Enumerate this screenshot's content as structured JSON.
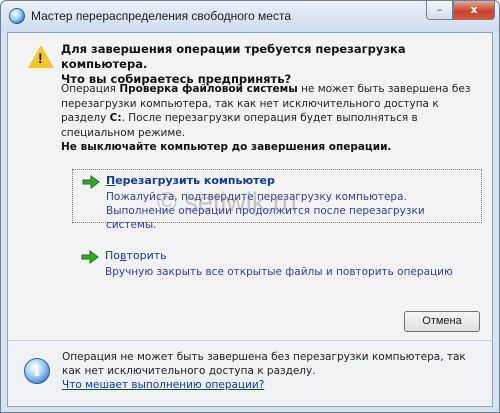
{
  "window": {
    "title": "Мастер перераспределения свободного места",
    "minimize_glyph": "–",
    "close_glyph": "x"
  },
  "dialog": {
    "heading_line1": "Для завершения операции требуется перезагрузка компьютера.",
    "heading_line2": "Что вы собираетесь предпринять?",
    "body_prefix": "Операция ",
    "body_operation": "Проверка файловой системы",
    "body_mid": " не может быть завершена без перезагрузки компьютера, так как нет исключительного доступа к разделу ",
    "body_drive": "C:",
    "body_suffix": ". После перезагрузки операция будет выполняться в специальном режиме.",
    "body_warning": "Не выключайте компьютер до завершения операции."
  },
  "options": [
    {
      "title_underlined_letter": "П",
      "title_rest": "ерезагрузить компьютер",
      "description": "Пожалуйста, подтвердите перезагрузку компьютера. Выполнение операции продолжится после перезагрузки системы.",
      "icon": "green-arrow-icon"
    },
    {
      "title_prefix": "По",
      "title_underlined_letter": "в",
      "title_rest": "торить",
      "description": "Вручную закрыть все открытые файлы и повторить операцию",
      "icon": "green-arrow-icon"
    }
  ],
  "buttons": {
    "cancel": "Отмена"
  },
  "footer": {
    "text": "Операция не может быть завершена без перезагрузки компьютера, так как нет исключительного доступа к разделу.",
    "link": "Что мешает выполнению операции?",
    "icon": "info-icon"
  },
  "watermark": "© setiwik.ru",
  "colors": {
    "link": "#0f3aa7",
    "arrow_green": "#3aa32c",
    "frame": "#d7e3ef"
  }
}
